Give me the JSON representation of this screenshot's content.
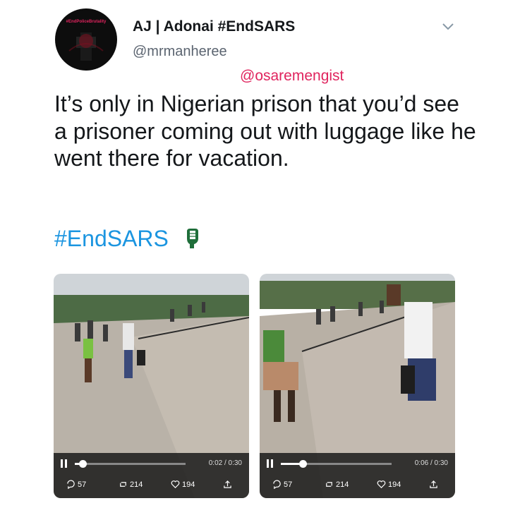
{
  "profile": {
    "avatar_text": "#EndPoliceBrutality",
    "display_name": "AJ | Adonai #EndSARS",
    "handle": "@mrmanheree"
  },
  "watermark": "@osaremengist",
  "tweet": {
    "text": "It’s only in Nigerian prison that you’d see a prisoner coming out with luggage like he went there for vacation.",
    "hashtag": "#EndSARS"
  },
  "videos": [
    {
      "time": "0:02 / 0:30",
      "progress": 0.07,
      "replies": "57",
      "retweets": "214",
      "likes": "194"
    },
    {
      "time": "0:06 / 0:30",
      "progress": 0.2,
      "replies": "57",
      "retweets": "214",
      "likes": "194"
    }
  ],
  "icons": {
    "chevron": "chevron-down-icon",
    "fist": "raised-fist-icon",
    "play": "pause-icon",
    "reply": "reply-icon",
    "retweet": "retweet-icon",
    "like": "heart-icon",
    "share": "share-icon"
  },
  "colors": {
    "hashtag": "#1b95e0",
    "watermark": "#e0245e",
    "secondary_text": "#5b6470"
  }
}
